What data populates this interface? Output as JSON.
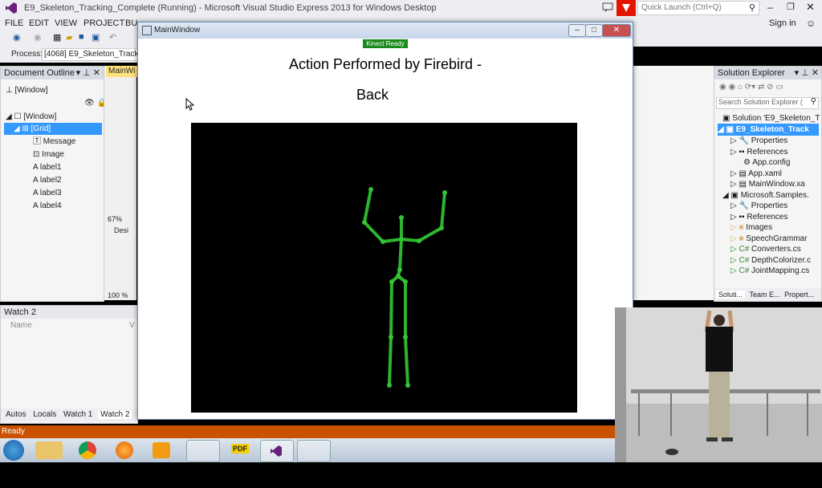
{
  "vs": {
    "title": "E9_Skeleton_Tracking_Complete (Running) - Microsoft Visual Studio Express 2013 for Windows Desktop",
    "quick_launch": "Quick Launch (Ctrl+Q)",
    "sign_in": "Sign in",
    "menu": [
      "FILE",
      "EDIT",
      "VIEW",
      "PROJECT",
      "BU"
    ],
    "process_label": "Process:",
    "process_value": "[4068] E9_Skeleton_Tracking_",
    "status": "Ready"
  },
  "document_outline": {
    "title": "Document Outline",
    "rows": [
      "[Window]",
      "[Window]",
      "[Grid]",
      "Message",
      "Image",
      "label1",
      "label2",
      "label3",
      "label4"
    ]
  },
  "designer": {
    "tab": "MainWi",
    "zoom1": "67%",
    "zoom2": "100 %",
    "design_tab": "Desi"
  },
  "watch": {
    "title": "Watch 2",
    "col_name": "Name",
    "col_v": "V",
    "tabs": [
      "Autos",
      "Locals",
      "Watch 1",
      "Watch 2"
    ]
  },
  "solution_explorer": {
    "title": "Solution Explorer",
    "search_placeholder": "Search Solution Explorer (",
    "items": [
      "Solution 'E9_Skeleton_T",
      "E9_Skeleton_Track",
      "Properties",
      "References",
      "App.config",
      "App.xaml",
      "MainWindow.xa",
      "Microsoft.Samples.",
      "Properties",
      "References",
      "Images",
      "SpeechGrammar",
      "Converters.cs",
      "DepthColorizer.c",
      "JointMapping.cs"
    ],
    "tabs": [
      "Soluti...",
      "Team E...",
      "Propert..."
    ]
  },
  "mainwindow": {
    "title": "MainWindow",
    "kinect_status": "Kinect Ready",
    "action_label": "Action Performed by Firebird -",
    "action_value": "Back"
  },
  "colors": {
    "vs_bg": "#eeeef2",
    "status_bar": "#ca5100",
    "skeleton": "#2db52d",
    "kinect_badge": "#1a8a1a"
  }
}
